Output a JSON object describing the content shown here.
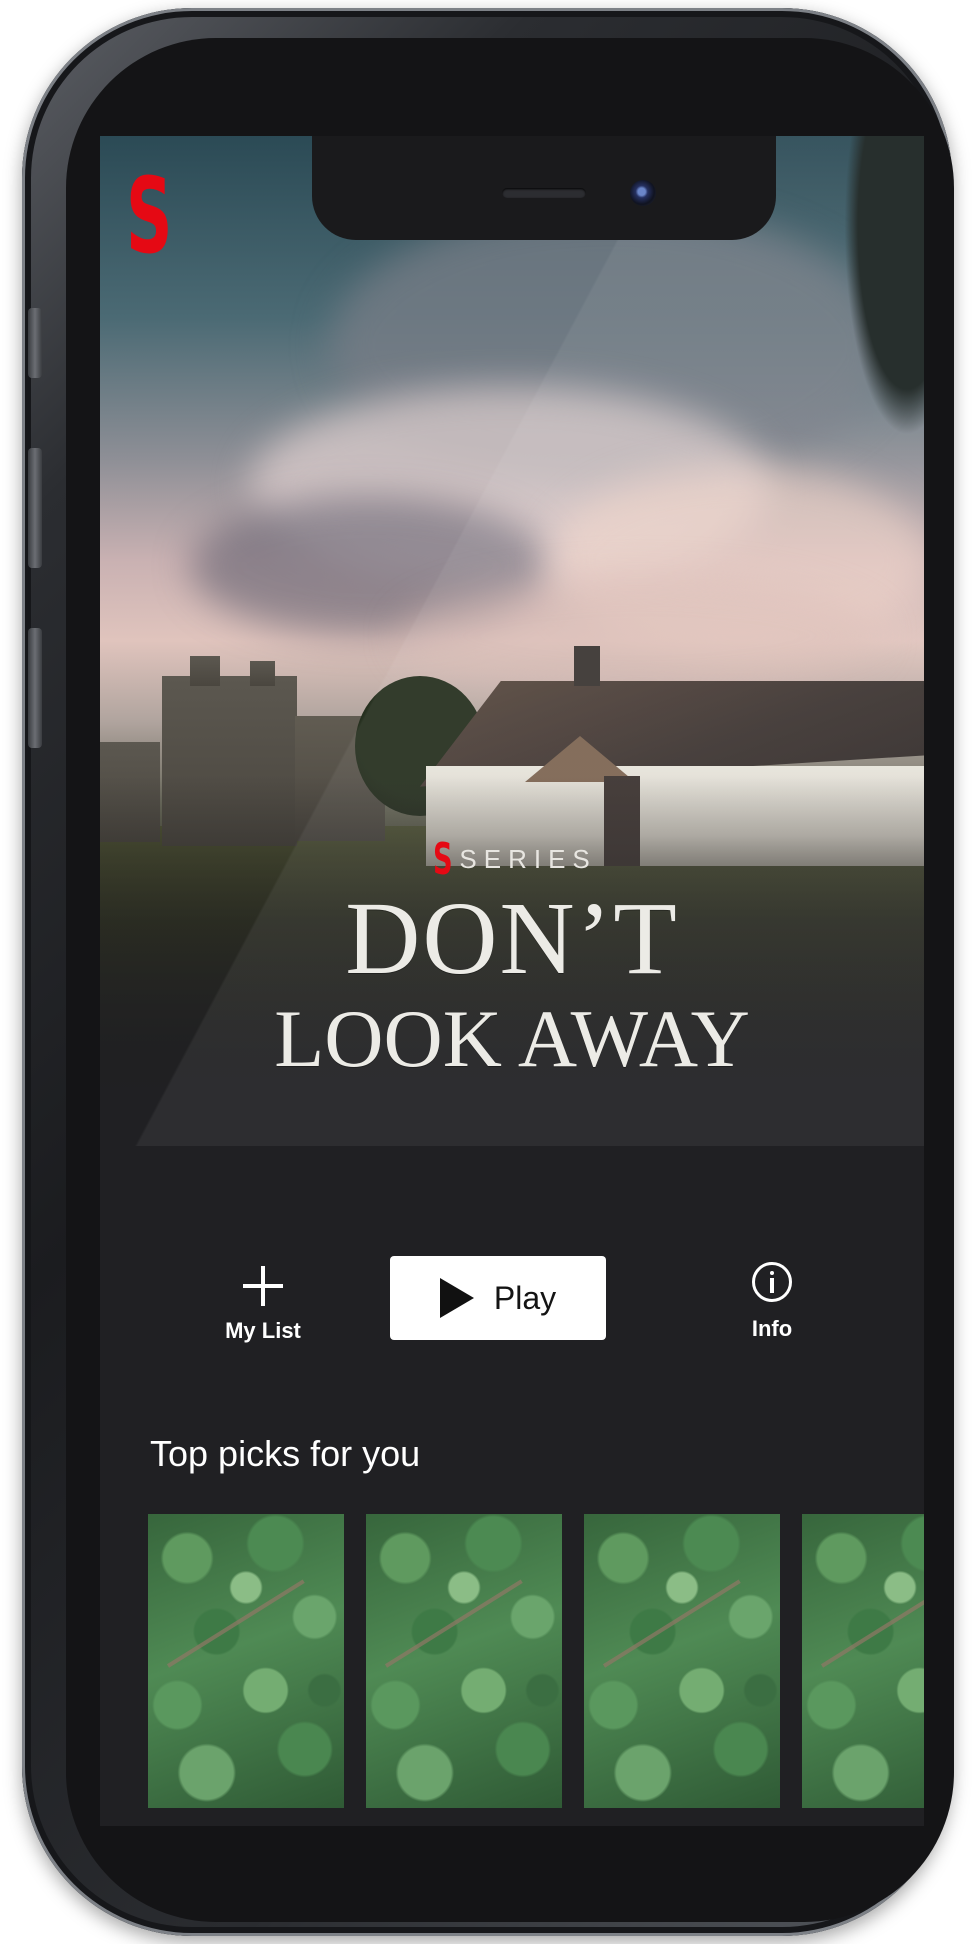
{
  "app": {
    "brand_logo": "S",
    "accent_color": "#e50914"
  },
  "hero": {
    "series_logo": "S",
    "series_label": "SERIES",
    "title_line1": "DON’T",
    "title_line2": "LOOK AWAY"
  },
  "actions": {
    "my_list": {
      "icon": "plus-icon",
      "label": "My List"
    },
    "play": {
      "icon": "play-icon",
      "label": "Play"
    },
    "info": {
      "icon": "info-icon",
      "label": "Info"
    }
  },
  "row": {
    "title": "Top picks for you",
    "thumbnail_count": 4
  }
}
